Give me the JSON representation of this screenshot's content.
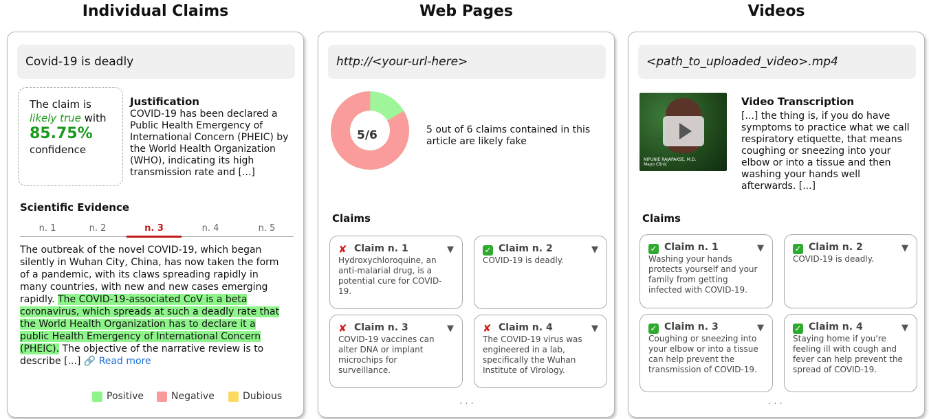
{
  "titles": {
    "claims": "Individual Claims",
    "web": "Web Pages",
    "videos": "Videos"
  },
  "claim_panel": {
    "input": "Covid-19 is deadly",
    "verdict": {
      "line1": "The claim is",
      "likely": "likely true",
      "with": " with",
      "percent": "85.75%",
      "confidence": "confidence"
    },
    "justification_title": "Justification",
    "justification_lines": [
      "COVID-19 has been declared a",
      "Public Health Emergency of",
      "International Concern (PHEIC) by",
      "the World Health Organization",
      "(WHO), indicating its high",
      "transmission rate and [...]"
    ],
    "evidence_title": "Scientific Evidence",
    "tabs": [
      "n. 1",
      "n. 2",
      "n. 3",
      "n. 4",
      "n. 5"
    ],
    "active_tab": "n. 3",
    "evidence_plain_lines": [
      "The outbreak of the novel COVID-19, which began",
      "silently in Wuhan City, China, has now taken the form",
      "of a pandemic, with its claws spreading rapidly in",
      "many countries, with new and new cases emerging"
    ],
    "evidence_line5_plain": "rapidly. ",
    "evidence_line5_hl": "The COVID-19-associated CoV is a beta",
    "evidence_hl_lines": [
      "coronavirus, which spreads at such a deadly rate that",
      "the World Health Organization has to declare it a",
      "public Health Emergency of International Concern"
    ],
    "evidence_line9_hl": "(PHEIC).",
    "evidence_line9_plain": " The objective of the narrative review is to",
    "evidence_last": "describe [...] ",
    "read_more": "Read more",
    "legend": [
      {
        "label": "Positive",
        "color": "#8ef58a"
      },
      {
        "label": "Negative",
        "color": "#f99a9a"
      },
      {
        "label": "Dubious",
        "color": "#fcd95f"
      }
    ]
  },
  "web_panel": {
    "input": "http://<your-url-here>",
    "donut": {
      "fake": 5,
      "total": 6,
      "label": "5/6",
      "fake_color": "#fa9c9c",
      "real_color": "#9ef59a"
    },
    "summary_lines": [
      "5 out of 6 claims contained in this",
      "article are likely fake"
    ],
    "claims_title": "Claims",
    "claims": [
      {
        "title": "Claim n. 1",
        "verdict": "fake",
        "lines": [
          "Hydroxychloroquine, an",
          "anti-malarial drug, is a",
          "potential cure for COVID-",
          "19."
        ]
      },
      {
        "title": "Claim n. 2",
        "verdict": "true",
        "lines": [
          "COVID-19 is deadly."
        ]
      },
      {
        "title": "Claim n. 3",
        "verdict": "fake",
        "lines": [
          "COVID-19 vaccines can",
          "alter DNA or implant",
          "microchips for",
          "surveillance."
        ]
      },
      {
        "title": "Claim n. 4",
        "verdict": "fake",
        "lines": [
          "The COVID-19 virus was",
          "engineered in a lab,",
          "specifically the Wuhan",
          "Institute of Virology."
        ]
      }
    ],
    "ellipsis": ". . ."
  },
  "video_panel": {
    "input": "<path_to_uploaded_video>.mp4",
    "thumb_caption": [
      "NIPUNIE RAJAPAKSE, M.D.",
      "Mayo Clinic"
    ],
    "transcription_title": "Video Transcription",
    "transcription_lines": [
      "[...] the thing is, if you do have",
      "symptoms to practice what we call",
      "respiratory etiquette, that means",
      "coughing or sneezing into your",
      "elbow or into a tissue and then",
      "washing your hands well",
      "afterwards. [...]"
    ],
    "claims_title": "Claims",
    "claims": [
      {
        "title": "Claim n. 1",
        "verdict": "true",
        "lines": [
          "Washing your hands",
          "protects yourself and your",
          "family from getting",
          "infected with COVID-19."
        ]
      },
      {
        "title": "Claim n. 2",
        "verdict": "true",
        "lines": [
          "COVID-19 is deadly."
        ]
      },
      {
        "title": "Claim n. 3",
        "verdict": "true",
        "lines": [
          "Coughing or sneezing into",
          "your elbow or into a tissue",
          "can help prevent the",
          "transmission of COVID-19."
        ]
      },
      {
        "title": "Claim n. 4",
        "verdict": "true",
        "lines": [
          "Staying home if you're",
          "feeling ill with cough and",
          "fever can help prevent the",
          "spread of COVID-19."
        ]
      }
    ],
    "ellipsis": ". . ."
  }
}
